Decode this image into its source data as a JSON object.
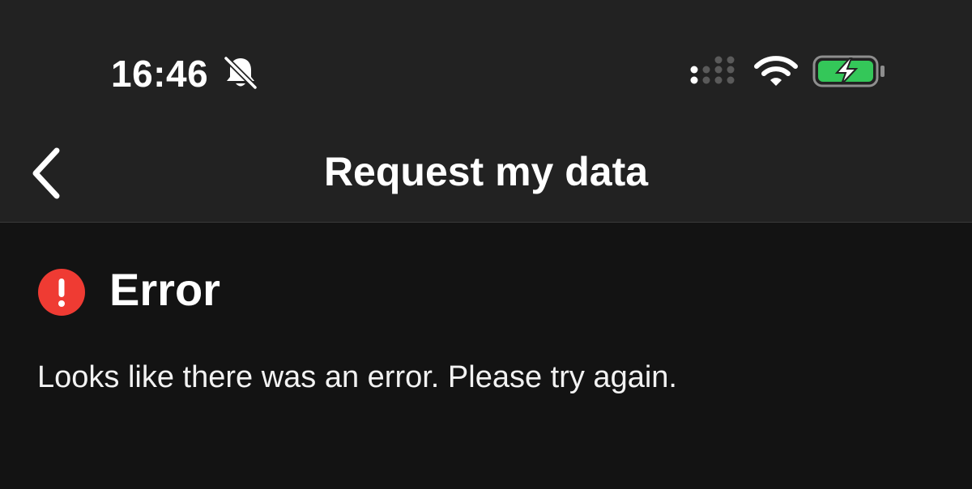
{
  "status_bar": {
    "time": "16:46",
    "icons": {
      "mute": "bell-slash-icon",
      "signal": "cellular-signal-icon",
      "wifi": "wifi-icon",
      "battery": "battery-charging-icon"
    },
    "battery_color": "#34c759"
  },
  "nav": {
    "back_icon": "chevron-left-icon",
    "title": "Request my data"
  },
  "content": {
    "error_icon": "exclamation-circle-icon",
    "error_icon_color": "#ef3b33",
    "title": "Error",
    "message": "Looks like there was an error. Please try again."
  }
}
